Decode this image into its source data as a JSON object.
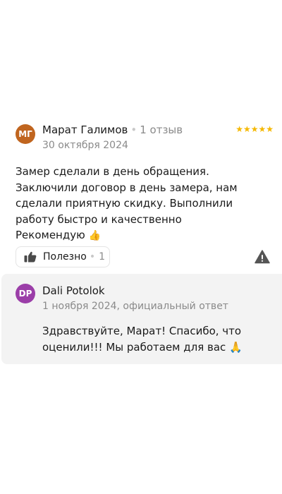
{
  "review": {
    "author_initials": "МГ",
    "author_name": "Марат Галимов",
    "author_reviews": "1 отзыв",
    "date": "30 октября 2024",
    "rating": 5,
    "stars": "★★★★★",
    "text": "Замер сделали в день обращения. Заключили договор в день замера, нам сделали приятную скидку. Выполнили работу быстро и качественно\nРекомендую",
    "emoji": "👍",
    "useful_label": "Полезно",
    "useful_count": "1"
  },
  "answer": {
    "author_initials": "DP",
    "author_name": "Dali Potolok",
    "date": "1 ноября 2024, официальный ответ",
    "text": "Здравствуйте, Марат! Спасибо, что оценили!!! Мы работаем для вас",
    "emoji": "🙏"
  },
  "colors": {
    "avatar_review": "#c0651f",
    "avatar_answer": "#9b3ea8",
    "stars": "#f5b800"
  }
}
